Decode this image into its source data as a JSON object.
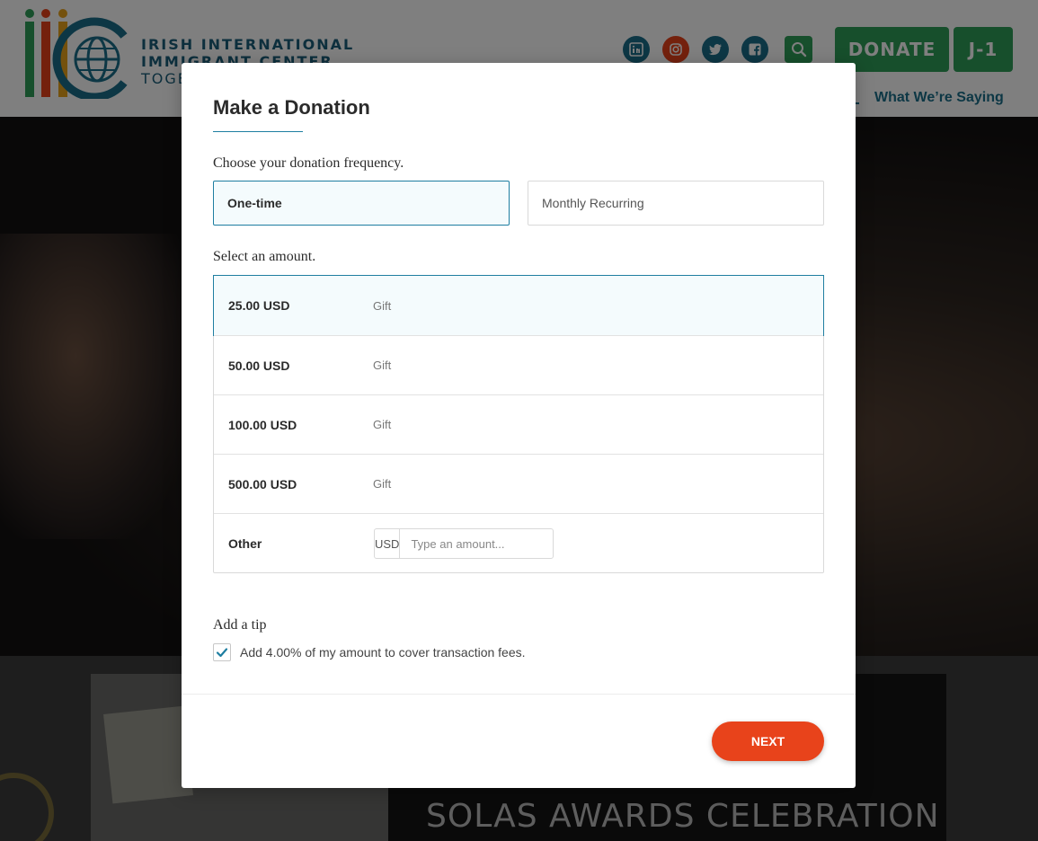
{
  "site": {
    "org_name_line1": "IRISH INTERNATIONAL",
    "org_name_line2": "IMMIGRANT CENTER",
    "org_tagline": "TOGE",
    "donate_label": "DONATE",
    "j1_label": "J-1",
    "nav_link": "What We’re Saying",
    "banner_text": "SOLAS AWARDS CELEBRATION",
    "social_icons": [
      "linkedin-icon",
      "instagram-icon",
      "twitter-icon",
      "facebook-icon"
    ],
    "colors": {
      "green": "#2e9e58",
      "blue": "#1b6f8a",
      "orange": "#e8431b"
    }
  },
  "modal": {
    "title": "Make a Donation",
    "frequency_label": "Choose your donation frequency.",
    "frequencies": [
      {
        "label": "One-time",
        "selected": true
      },
      {
        "label": "Monthly Recurring",
        "selected": false
      }
    ],
    "amount_label": "Select an amount.",
    "amounts": [
      {
        "value": "25.00 USD",
        "desc": "Gift",
        "selected": true
      },
      {
        "value": "50.00 USD",
        "desc": "Gift",
        "selected": false
      },
      {
        "value": "100.00 USD",
        "desc": "Gift",
        "selected": false
      },
      {
        "value": "500.00 USD",
        "desc": "Gift",
        "selected": false
      }
    ],
    "other": {
      "label": "Other",
      "currency": "USD",
      "placeholder": "Type an amount...",
      "value": ""
    },
    "tip": {
      "heading": "Add a tip",
      "text": "Add 4.00% of my amount to cover transaction fees.",
      "checked": true
    },
    "next_label": "NEXT",
    "accent_color": "#1e7ea1"
  }
}
